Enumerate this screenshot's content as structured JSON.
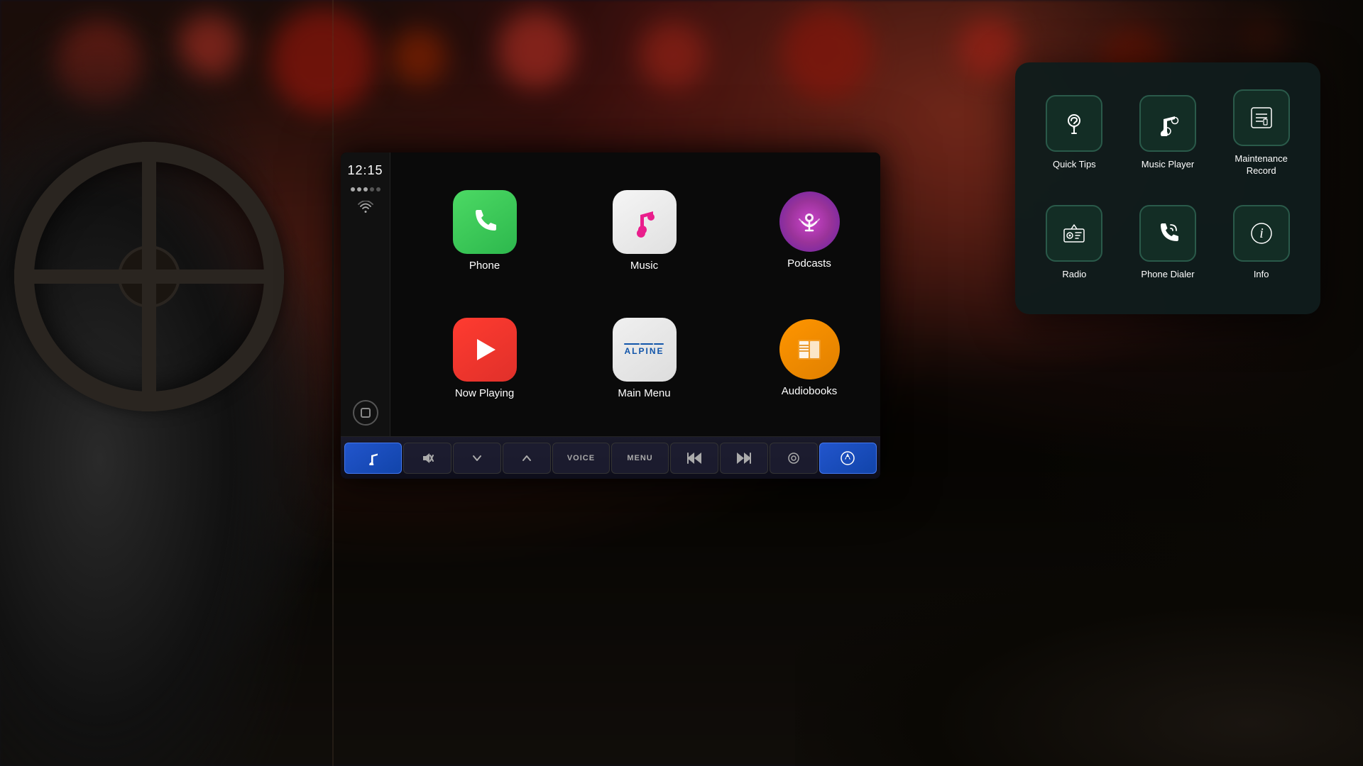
{
  "background": {
    "bokeh_colors": [
      "#cc3322",
      "#ee4433",
      "#ff5544",
      "#dd3311",
      "#bb2211"
    ]
  },
  "sidebar": {
    "time": "12:15",
    "home_button_label": "⬜"
  },
  "app_grid": {
    "apps": [
      {
        "id": "phone",
        "label": "Phone",
        "icon": "📞",
        "icon_type": "phone"
      },
      {
        "id": "music",
        "label": "Music",
        "icon": "♪",
        "icon_type": "music"
      },
      {
        "id": "now-playing",
        "label": "Now Playing",
        "icon": "▶",
        "icon_type": "now-playing"
      },
      {
        "id": "main-menu",
        "label": "Main Menu",
        "icon_type": "main-menu"
      }
    ]
  },
  "right_apps": [
    {
      "id": "podcasts",
      "label": "Podcasts",
      "icon": "🎙"
    },
    {
      "id": "audiobooks",
      "label": "Audiobooks",
      "icon": "📚"
    }
  ],
  "control_bar": {
    "buttons": [
      {
        "id": "music-btn",
        "icon": "♪",
        "active": true
      },
      {
        "id": "mute-btn",
        "icon": "🔇",
        "active": false
      },
      {
        "id": "down-btn",
        "icon": "∨",
        "active": false
      },
      {
        "id": "up-btn",
        "icon": "∧",
        "active": false
      },
      {
        "id": "voice-btn",
        "label": "VOICE",
        "active": false
      },
      {
        "id": "menu-btn",
        "label": "MENU",
        "active": false
      },
      {
        "id": "prev-btn",
        "icon": "⏮",
        "active": false
      },
      {
        "id": "next-btn",
        "icon": "⏭",
        "active": false
      },
      {
        "id": "eject-btn",
        "icon": "⏏",
        "active": false
      },
      {
        "id": "nav-btn",
        "icon": "◉",
        "active": true
      }
    ]
  },
  "app_drawer": {
    "items": [
      {
        "id": "quick-tips",
        "label": "Quick Tips",
        "icon": "💡"
      },
      {
        "id": "music-player",
        "label": "Music Player",
        "icon": "♪"
      },
      {
        "id": "maintenance-record",
        "label": "Maintenance\nRecord",
        "icon": "⚙"
      },
      {
        "id": "radio",
        "label": "Radio",
        "icon": "📺"
      },
      {
        "id": "phone-dialer",
        "label": "Phone Dialer",
        "icon": "📞"
      },
      {
        "id": "info",
        "label": "Info",
        "icon": "ℹ"
      }
    ]
  }
}
